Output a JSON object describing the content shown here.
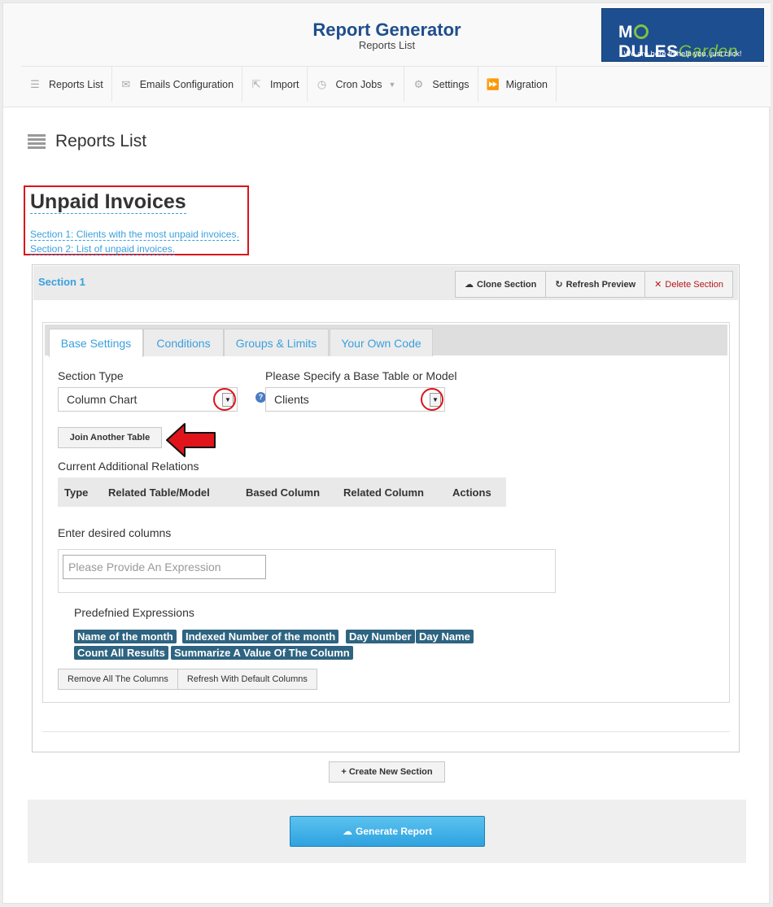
{
  "header": {
    "title": "Report Generator",
    "subtitle": "Reports List",
    "brand": {
      "name_part1": "M",
      "name_part2": "DULES",
      "name_part3": "Garden",
      "tagline": "We are here to help you, just click!"
    }
  },
  "nav": [
    {
      "label": "Reports List",
      "icon": "list-icon"
    },
    {
      "label": "Emails Configuration",
      "icon": "envelope-icon"
    },
    {
      "label": "Import",
      "icon": "import-icon"
    },
    {
      "label": "Cron Jobs",
      "icon": "clock-icon"
    },
    {
      "label": "Settings",
      "icon": "gears-icon"
    },
    {
      "label": "Migration",
      "icon": "forward-icon"
    }
  ],
  "page": {
    "title": "Reports List"
  },
  "report": {
    "name": "Unpaid Invoices",
    "sections": [
      "Section 1: Clients with the most unpaid invoices.",
      "Section 2: List of unpaid invoices."
    ]
  },
  "section": {
    "name": "Section 1",
    "clone_label": "Clone Section",
    "refresh_label": "Refresh Preview",
    "delete_label": "Delete Section",
    "tabs": [
      "Base Settings",
      "Conditions",
      "Groups & Limits",
      "Your Own Code"
    ],
    "section_type_label": "Section Type",
    "section_type_value": "Column Chart",
    "base_table_label": "Please Specify a Base Table or Model",
    "base_table_value": "Clients",
    "help_glyph": "?",
    "join_label": "Join Another Table",
    "relations_label": "Current Additional Relations",
    "relations_columns": [
      "Type",
      "Related Table/Model",
      "Based Column",
      "Related Column",
      "Actions"
    ],
    "columns_label": "Enter desired columns",
    "columns_placeholder": "Please Provide An Expression",
    "predefined_label": "Predefnied Expressions",
    "expressions": [
      "Name of the month",
      "Indexed Number of the month",
      "Day Number",
      "Day Name",
      "Count All Results",
      "Summarize A Value Of The Column"
    ],
    "remove_columns_label": "Remove All The Columns",
    "refresh_columns_label": "Refresh With Default Columns"
  },
  "footer": {
    "create_section_label": "Create New Section",
    "generate_label": "Generate Report"
  },
  "colors": {
    "accent": "#3aa0dd",
    "title": "#1f4e8c",
    "highlight": "#d9151c",
    "badge": "#2e6481"
  }
}
